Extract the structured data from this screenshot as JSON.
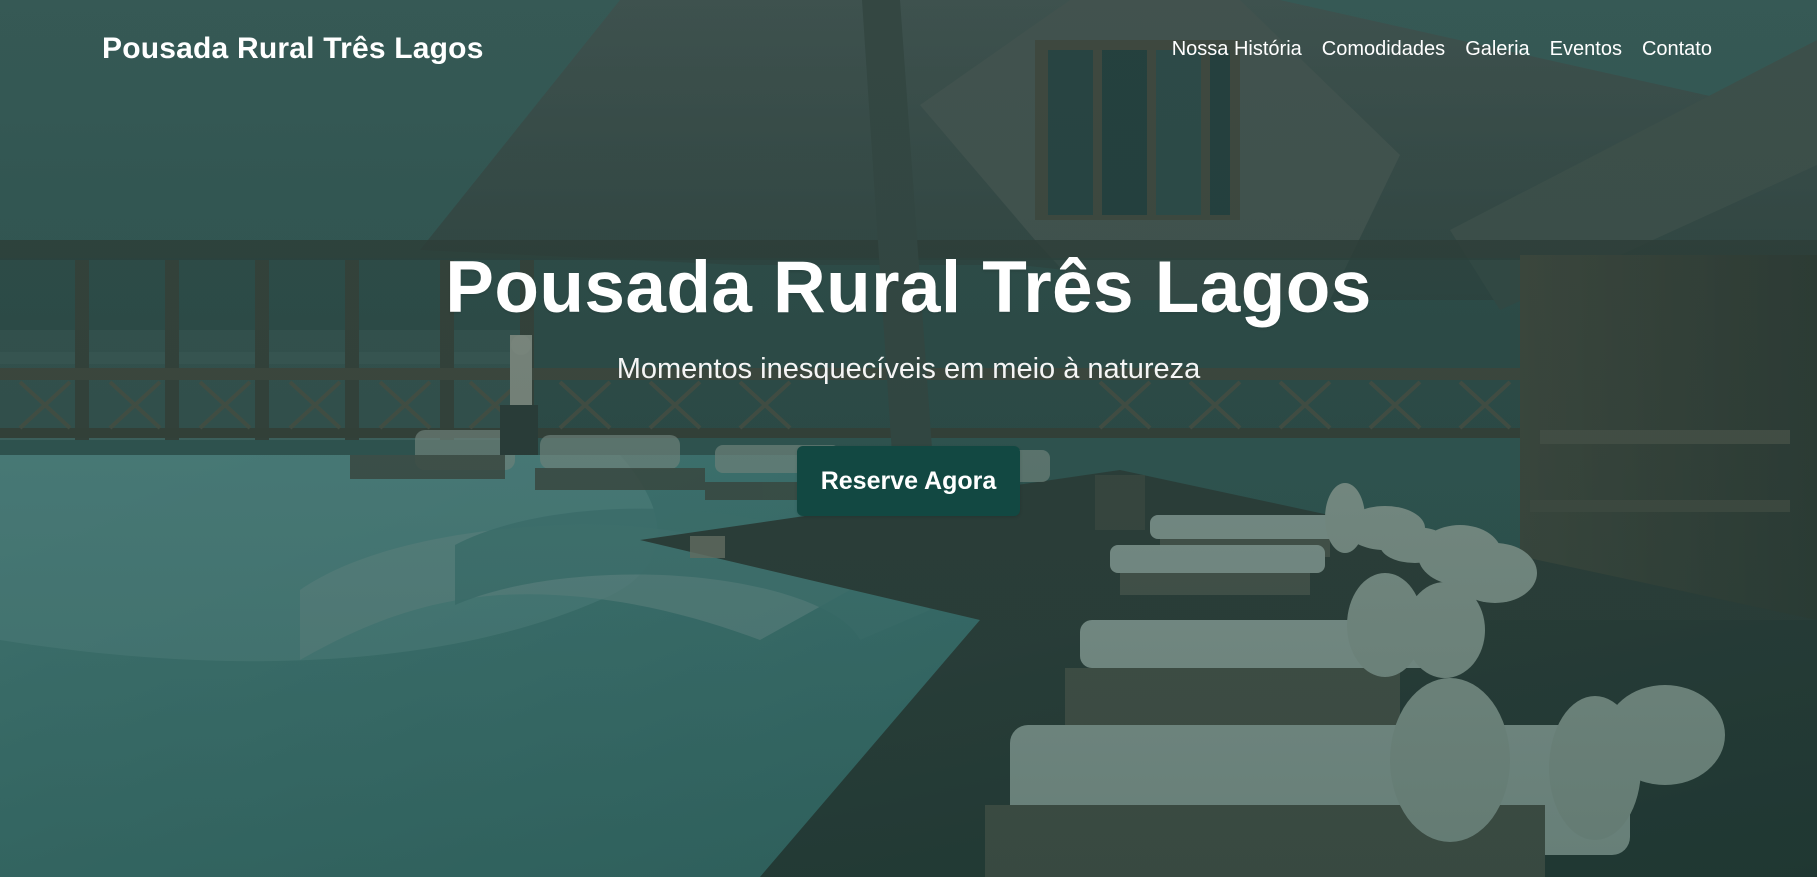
{
  "header": {
    "brand": "Pousada Rural Três Lagos",
    "nav": [
      "Nossa História",
      "Comodidades",
      "Galeria",
      "Eventos",
      "Contato"
    ]
  },
  "hero": {
    "title": "Pousada Rural Três Lagos",
    "subtitle": "Momentos inesquecíveis em meio à natureza",
    "cta_label": "Reserve Agora"
  },
  "colors": {
    "overlay": "#1c4744",
    "button": "#124842",
    "text": "#ffffff"
  }
}
